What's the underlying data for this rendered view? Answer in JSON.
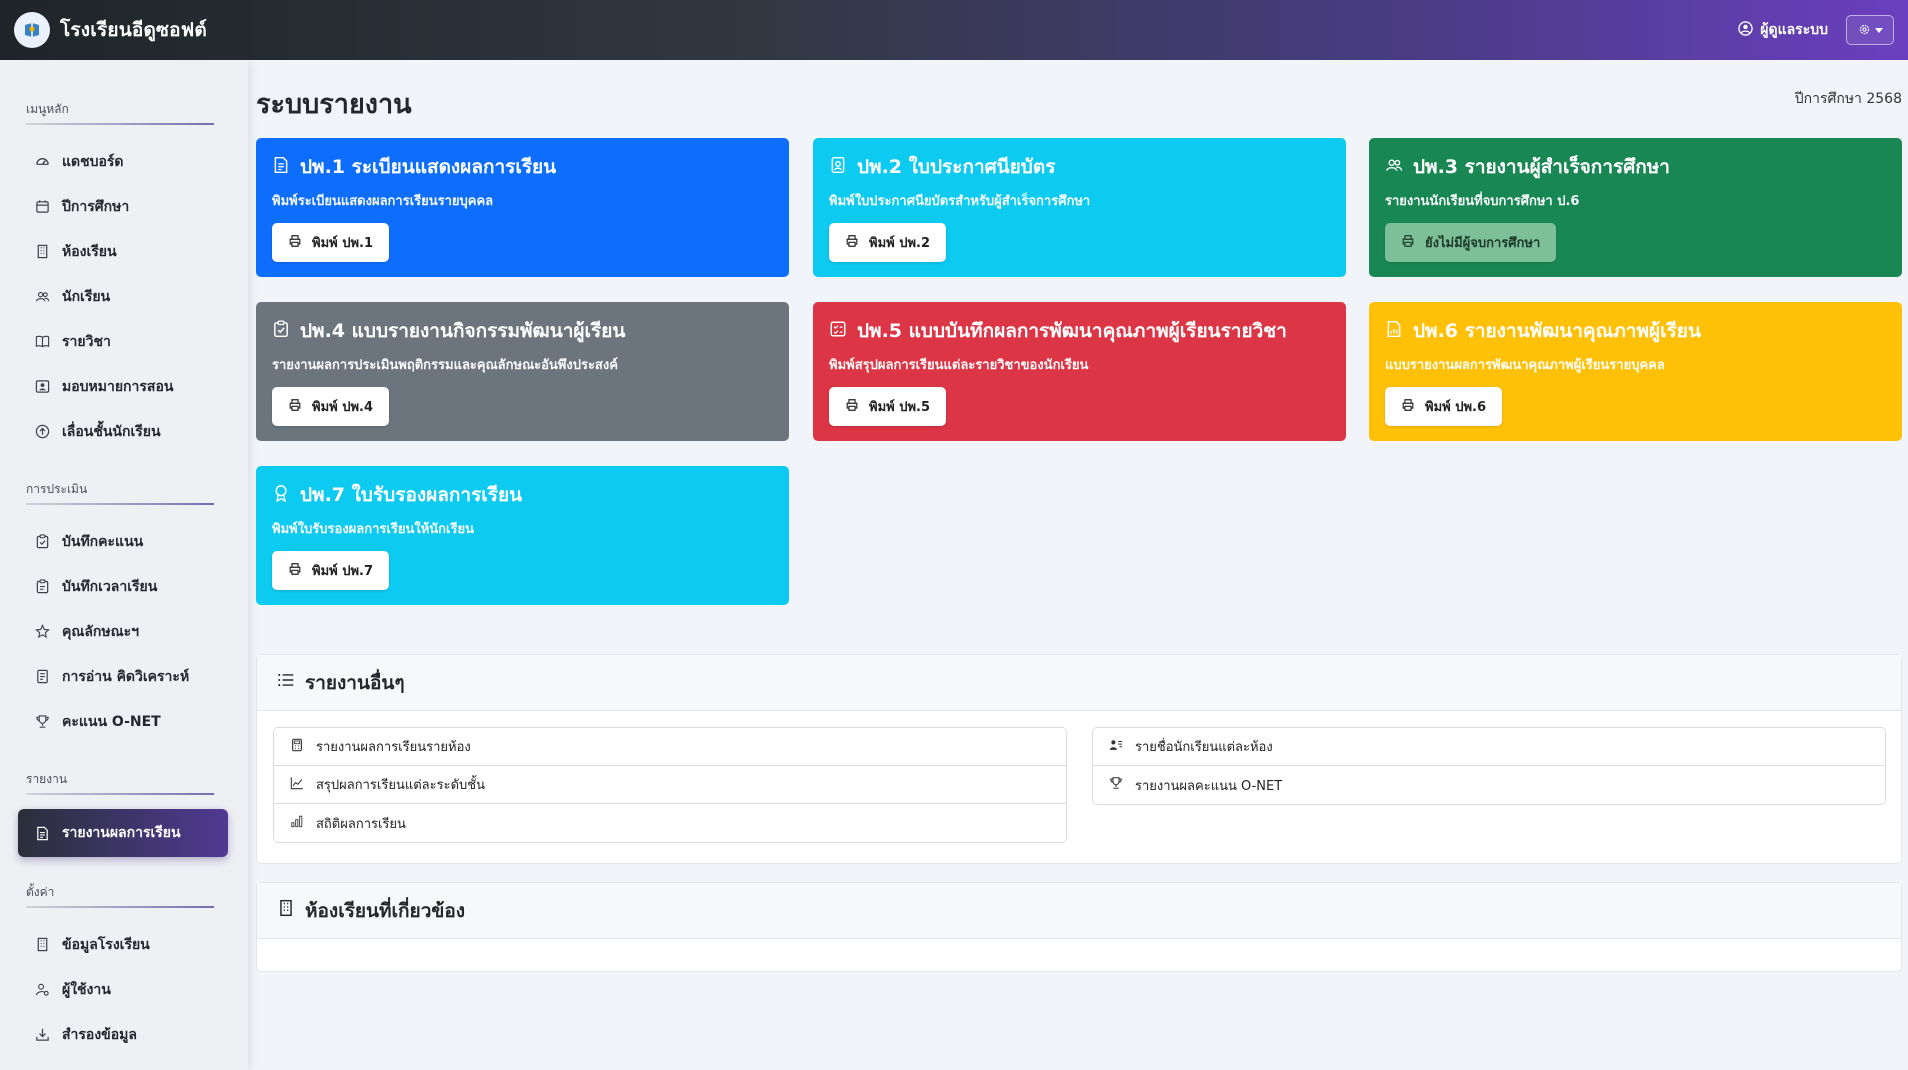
{
  "app": {
    "name": "โรงเรียนอีดูซอฟต์",
    "user": "ผู้ดูแลระบบ"
  },
  "sidebar": {
    "sections": [
      {
        "title": "เมนูหลัก",
        "items": [
          {
            "label": "แดชบอร์ด",
            "icon": "dashboard-icon"
          },
          {
            "label": "ปีการศึกษา",
            "icon": "calendar-icon"
          },
          {
            "label": "ห้องเรียน",
            "icon": "building-icon"
          },
          {
            "label": "นักเรียน",
            "icon": "people-icon"
          },
          {
            "label": "รายวิชา",
            "icon": "book-icon"
          },
          {
            "label": "มอบหมายการสอน",
            "icon": "teacher-icon"
          },
          {
            "label": "เลื่อนชั้นนักเรียน",
            "icon": "arrow-up-circle-icon"
          }
        ]
      },
      {
        "title": "การประเมิน",
        "items": [
          {
            "label": "บันทึกคะแนน",
            "icon": "clipboard-check-icon"
          },
          {
            "label": "บันทึกเวลาเรียน",
            "icon": "clock-icon"
          },
          {
            "label": "คุณลักษณะฯ",
            "icon": "star-icon"
          },
          {
            "label": "การอ่าน คิดวิเคราะห์",
            "icon": "journal-icon"
          },
          {
            "label": "คะแนน O-NET",
            "icon": "trophy-icon"
          }
        ]
      },
      {
        "title": "รายงาน",
        "items": [
          {
            "label": "รายงานผลการเรียน",
            "icon": "file-text-icon",
            "active": true
          }
        ]
      },
      {
        "title": "ตั้งค่า",
        "items": [
          {
            "label": "ข้อมูลโรงเรียน",
            "icon": "building-icon"
          },
          {
            "label": "ผู้ใช้งาน",
            "icon": "user-gear-icon"
          },
          {
            "label": "สำรองข้อมูล",
            "icon": "download-icon"
          }
        ]
      }
    ]
  },
  "main": {
    "title": "ระบบรายงาน",
    "year_label": "ปีการศึกษา 2568",
    "cards": [
      {
        "title": "ปพ.1 ระเบียนแสดงผลการเรียน",
        "desc": "พิมพ์ระเบียนแสดงผลการเรียนรายบุคคล",
        "button": "พิมพ์ ปพ.1",
        "color": "#0d6efd",
        "icon": "file-text-icon"
      },
      {
        "title": "ปพ.2 ใบประกาศนียบัตร",
        "desc": "พิมพ์ใบประกาศนียบัตรสำหรับผู้สำเร็จการศึกษา",
        "button": "พิมพ์ ปพ.2",
        "color": "#0dcaf0",
        "icon": "person-badge-icon"
      },
      {
        "title": "ปพ.3 รายงานผู้สำเร็จการศึกษา",
        "desc": "รายงานนักเรียนที่จบการศึกษา ป.6",
        "button": "ยังไม่มีผู้จบการศึกษา",
        "color": "#198754",
        "icon": "people-icon",
        "disabled": true
      },
      {
        "title": "ปพ.4 แบบรายงานกิจกรรมพัฒนาผู้เรียน",
        "desc": "รายงานผลการประเมินพฤติกรรมและคุณลักษณะอันพึงประสงค์",
        "button": "พิมพ์ ปพ.4",
        "color": "#6c757d",
        "icon": "clipboard-check-icon"
      },
      {
        "title": "ปพ.5 แบบบันทึกผลการพัฒนาคุณภาพผู้เรียนรายวิชา",
        "desc": "พิมพ์สรุปผลการเรียนแต่ละรายวิชาของนักเรียน",
        "button": "พิมพ์ ปพ.5",
        "color": "#dc3545",
        "icon": "check-square-icon"
      },
      {
        "title": "ปพ.6 รายงานพัฒนาคุณภาพผู้เรียน",
        "desc": "แบบรายงานผลการพัฒนาคุณภาพผู้เรียนรายบุคคล",
        "button": "พิมพ์ ปพ.6",
        "color": "#ffc107",
        "icon": "file-chart-icon"
      },
      {
        "title": "ปพ.7 ใบรับรองผลการเรียน",
        "desc": "พิมพ์ใบรับรองผลการเรียนให้นักเรียน",
        "button": "พิมพ์ ปพ.7",
        "color": "#0dcaf0",
        "icon": "award-icon"
      }
    ],
    "other_reports": {
      "title": "รายงานอื่นๆ",
      "left": [
        {
          "label": "รายงานผลการเรียนรายห้อง",
          "icon": "calculator-icon"
        },
        {
          "label": "สรุปผลการเรียนแต่ละระดับชั้น",
          "icon": "line-chart-icon"
        },
        {
          "label": "สถิติผลการเรียน",
          "icon": "bar-chart-icon"
        }
      ],
      "right": [
        {
          "label": "รายชื่อนักเรียนแต่ละห้อง",
          "icon": "person-lines-icon"
        },
        {
          "label": "รายงานผลคะแนน O-NET",
          "icon": "trophy-icon"
        }
      ]
    },
    "related_rooms": {
      "title": "ห้องเรียนที่เกี่ยวข้อง"
    }
  }
}
